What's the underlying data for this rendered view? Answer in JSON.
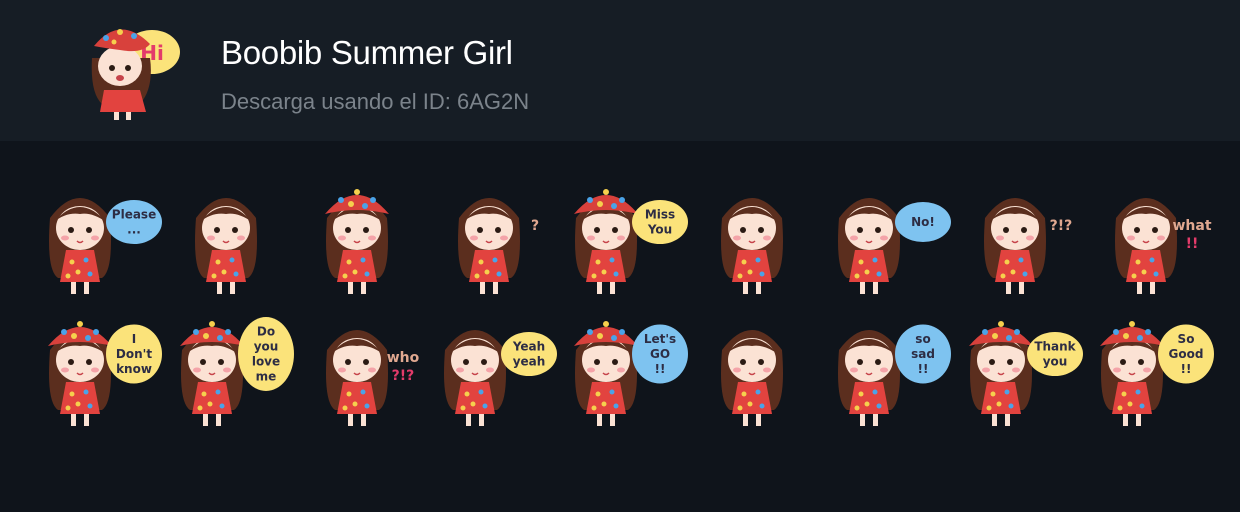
{
  "pack": {
    "title": "Boobib Summer Girl",
    "subtitle": "Descarga usando el ID: 6AG2N",
    "icon_name": "sticker-pack-icon",
    "icon_bubble": "Hi"
  },
  "colors": {
    "background": "#0f141b",
    "header": "#161d25",
    "hair": "#5b2e1e",
    "dress": "#e2433f",
    "hat": "#d8413c",
    "bubble_blue": "#7ec3f0",
    "bubble_yellow": "#fbe37a",
    "accent_pink": "#e33b6a"
  },
  "stickers": [
    {
      "id": "please",
      "hat": false,
      "bubble": "blue",
      "lines": [
        "Please",
        "..."
      ]
    },
    {
      "id": "shocked",
      "hat": false,
      "bubble": null,
      "lines": []
    },
    {
      "id": "annoyed-hat",
      "hat": true,
      "bubble": null,
      "lines": []
    },
    {
      "id": "question",
      "hat": false,
      "bubble": null,
      "lines": [
        "?"
      ]
    },
    {
      "id": "miss-you",
      "hat": true,
      "bubble": "yellow",
      "lines": [
        "Miss",
        "You"
      ]
    },
    {
      "id": "sigh",
      "hat": false,
      "bubble": null,
      "lines": []
    },
    {
      "id": "no",
      "hat": false,
      "bubble": "blue",
      "lines": [
        "No!"
      ]
    },
    {
      "id": "confused",
      "hat": false,
      "bubble": null,
      "lines": [
        "?!?"
      ]
    },
    {
      "id": "what",
      "hat": false,
      "bubble": null,
      "lines": [
        "what",
        "!!"
      ]
    },
    {
      "id": "i-dont-know",
      "hat": true,
      "bubble": "yellow",
      "lines": [
        "I",
        "Don't",
        "know"
      ]
    },
    {
      "id": "do-you-love-me",
      "hat": true,
      "bubble": "yellow",
      "lines": [
        "Do",
        "you",
        "love",
        "me"
      ]
    },
    {
      "id": "who",
      "hat": false,
      "bubble": null,
      "lines": [
        "who",
        "?!?"
      ]
    },
    {
      "id": "yeah-yeah",
      "hat": false,
      "bubble": "yellow",
      "lines": [
        "Yeah",
        "yeah"
      ]
    },
    {
      "id": "lets-go",
      "hat": true,
      "bubble": "blue",
      "lines": [
        "Let's",
        "GO",
        "!!"
      ]
    },
    {
      "id": "crying",
      "hat": false,
      "bubble": null,
      "lines": []
    },
    {
      "id": "so-sad",
      "hat": false,
      "bubble": "blue",
      "lines": [
        "so",
        "sad",
        "!!"
      ]
    },
    {
      "id": "thank-you",
      "hat": true,
      "bubble": "yellow",
      "lines": [
        "Thank",
        "you"
      ]
    },
    {
      "id": "so-good",
      "hat": true,
      "bubble": "yellow",
      "lines": [
        "So",
        "Good",
        "!!"
      ]
    }
  ]
}
